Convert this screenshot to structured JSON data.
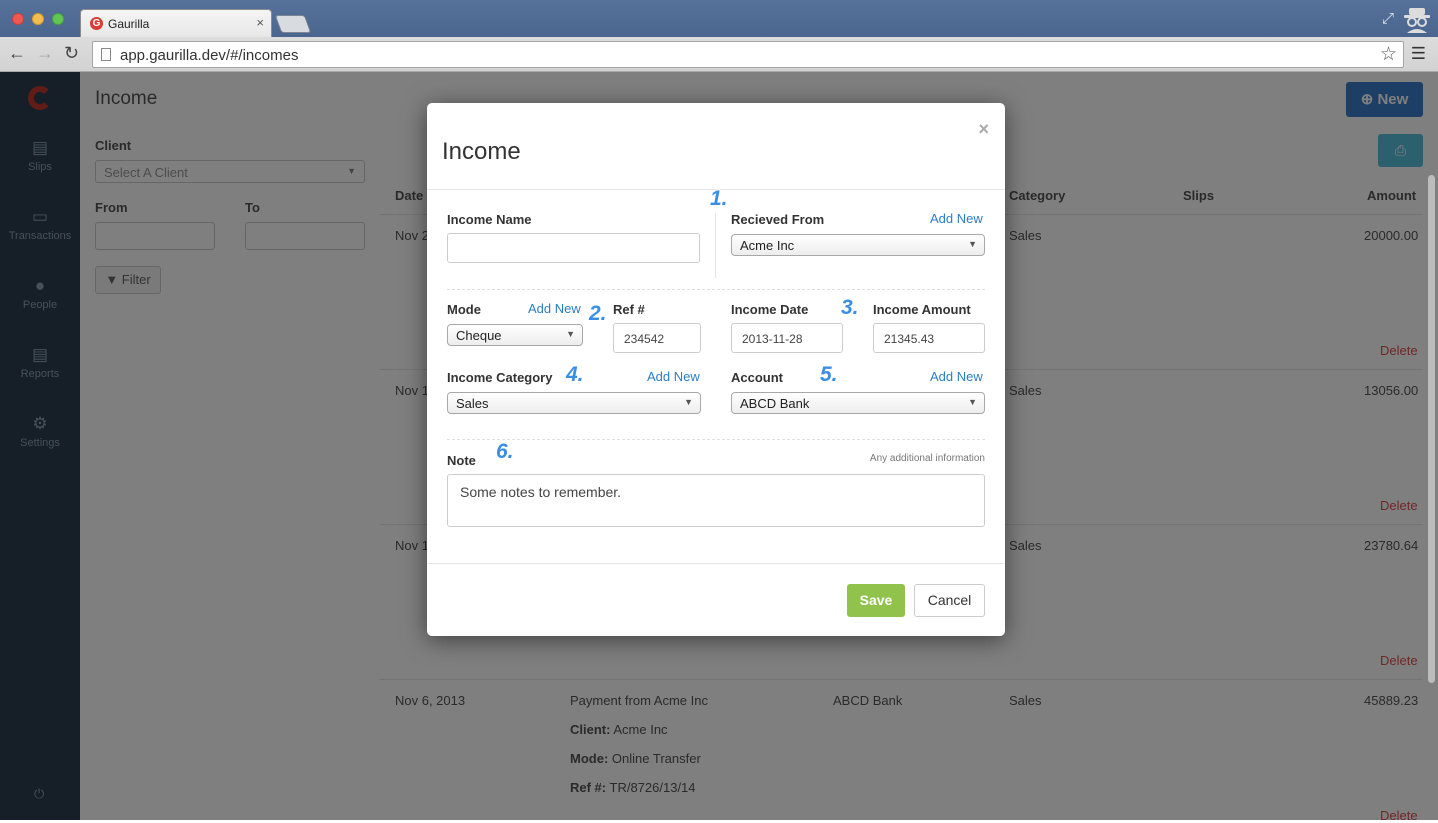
{
  "browser": {
    "tab_title": "Gaurilla",
    "tab_close": "×",
    "url": "app.gaurilla.dev/#/incomes",
    "favicon_letter": "G"
  },
  "sidebar": {
    "items": [
      {
        "label": "Slips",
        "icon": "document-icon"
      },
      {
        "label": "Transactions",
        "icon": "cash-icon"
      },
      {
        "label": "People",
        "icon": "person-icon"
      },
      {
        "label": "Reports",
        "icon": "report-icon"
      },
      {
        "label": "Settings",
        "icon": "gear-icon"
      }
    ]
  },
  "page": {
    "title": "Income",
    "new_button": "New",
    "filter": {
      "client_label": "Client",
      "client_placeholder": "Select A Client",
      "from_label": "From",
      "to_label": "To",
      "filter_button": "Filter"
    },
    "table": {
      "headers": {
        "date": "Date",
        "category": "Category",
        "slips": "Slips",
        "amount": "Amount"
      },
      "rows": [
        {
          "date": "Nov 2",
          "category": "Sales",
          "amount": "20000.00",
          "delete": "Delete"
        },
        {
          "date": "Nov 1",
          "category": "Sales",
          "amount": "13056.00",
          "delete": "Delete"
        },
        {
          "date": "Nov 1",
          "category": "Sales",
          "amount": "23780.64",
          "delete": "Delete"
        },
        {
          "date": "Nov 6, 2013",
          "description": "Payment from Acme Inc",
          "client_label": "Client:",
          "client": "Acme Inc",
          "mode_label": "Mode:",
          "mode": "Online Transfer",
          "ref_label": "Ref #:",
          "ref": "TR/8726/13/14",
          "account": "ABCD Bank",
          "category": "Sales",
          "amount": "45889.23",
          "delete": "Delete"
        }
      ]
    }
  },
  "modal": {
    "title": "Income",
    "close": "×",
    "income_name_label": "Income Name",
    "income_name_value": "",
    "received_from_label": "Recieved From",
    "received_from_add": "Add New",
    "received_from_value": "Acme Inc",
    "mode_label": "Mode",
    "mode_add": "Add New",
    "mode_value": "Cheque",
    "ref_label": "Ref #",
    "ref_value": "234542",
    "income_date_label": "Income Date",
    "income_date_value": "2013-11-28",
    "income_amount_label": "Income Amount",
    "income_amount_value": "21345.43",
    "category_label": "Income Category",
    "category_add": "Add New",
    "category_value": "Sales",
    "account_label": "Account",
    "account_add": "Add New",
    "account_value": "ABCD Bank",
    "note_label": "Note",
    "note_hint": "Any additional information",
    "note_value": "Some notes to remember.",
    "save": "Save",
    "cancel": "Cancel",
    "annotations": [
      "1.",
      "2.",
      "3.",
      "4.",
      "5.",
      "6."
    ]
  },
  "colors": {
    "sidebar": "#2c3e50",
    "primary": "#3a7fcb",
    "save": "#91c24b",
    "link": "#2a7ec8",
    "danger": "#d9534f",
    "annotation": "#3a8ee6"
  }
}
